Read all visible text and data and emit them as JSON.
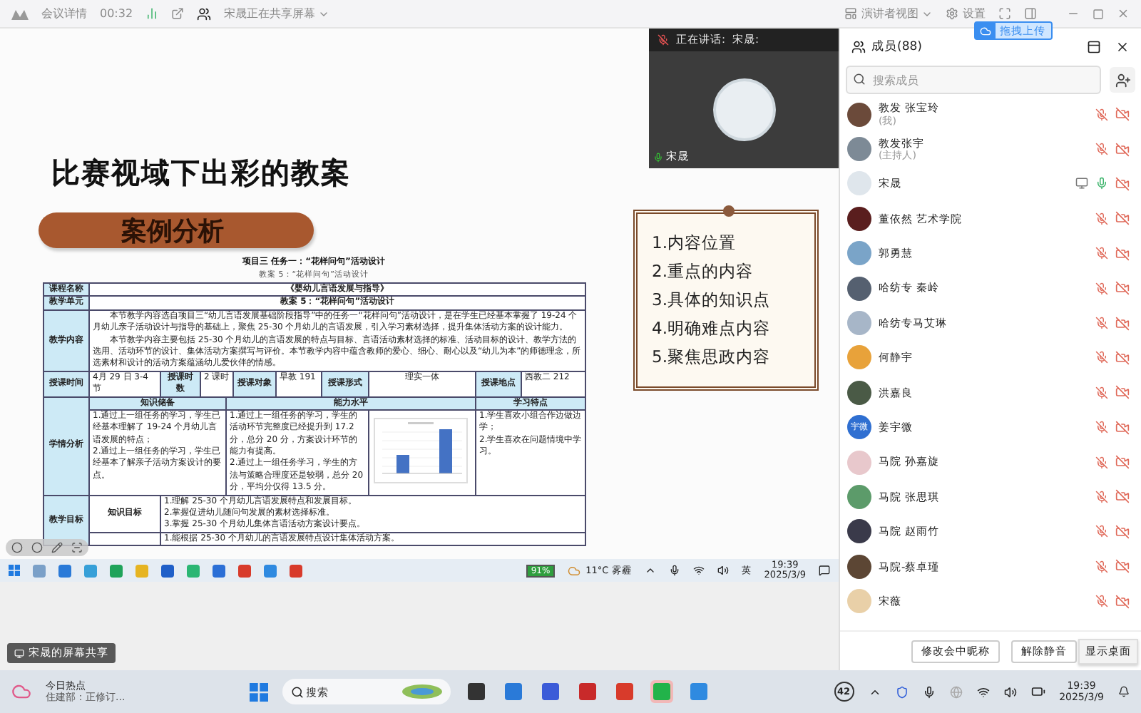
{
  "top_bar": {
    "meeting_details": "会议详情",
    "timer": "00:32",
    "sharing_status": "宋晟正在共享屏幕",
    "view_mode": "演讲者视图",
    "settings": "设置"
  },
  "upload_badge": "拖拽上传",
  "speaker_video": {
    "label": "正在讲话:",
    "speaker": "宋晟:",
    "name": "宋晟"
  },
  "slide": {
    "title": "比赛视域下出彩的教案",
    "section": "案例分析",
    "doc_title": "项目三  任务一：“花样问句”活动设计",
    "doc_subtitle": "教案 5：“花样问句”活动设计",
    "table": {
      "course": {
        "label": "课程名称",
        "value": "《婴幼儿言语发展与指导》"
      },
      "unit": {
        "label": "教学单元",
        "value": "教案 5：“花样问句”活动设计"
      },
      "content": {
        "label": "教学内容",
        "paragraphs": [
          "本节教学内容选自项目三“幼儿言语发展基础阶段指导”中的任务一“花样问句”活动设计，是在学生已经基本掌握了 19-24 个月幼儿亲子活动设计与指导的基础上，聚焦 25-30 个月幼儿的言语发展，引入学习素材选择，提升集体活动方案的设计能力。",
          "本节教学内容主要包括 25-30 个月幼儿的言语发展的特点与目标、言语活动素材选择的标准、活动目标的设计、教学方法的选用、活动环节的设计、集体活动方案撰写与评价。本节教学内容中蕴含教师的爱心、细心、耐心以及“幼儿为本”的师德理念，所选素材和设计的活动方案蕴涵幼儿爱伙伴的情感。"
        ]
      },
      "schedule": [
        {
          "label": "授课时间",
          "value": "4月 29 日 3-4 节"
        },
        {
          "label": "授课时数",
          "value": "2 课时"
        },
        {
          "label": "授课对象",
          "value": "早教 191"
        },
        {
          "label": "授课形式",
          "value": "理实一体"
        },
        {
          "label": "授课地点",
          "value": "西教二 212"
        }
      ],
      "analysis": {
        "label": "学情分析",
        "headers": [
          "知识储备",
          "能力水平",
          "学习特点"
        ],
        "knowledge": [
          "1.通过上一组任务的学习，学生已经基本理解了 19-24 个月幼儿言语发展的特点；",
          "2.通过上一组任务的学习，学生已经基本了解亲子活动方案设计的要点。"
        ],
        "ability": [
          "1.通过上一组任务的学习，学生的活动环节完整度已经提升到 17.2 分，总分 20 分，方案设计环节的能力有提高。",
          "2.通过上一组任务学习，学生的方法与策略合理度还是较弱，总分 20 分，平均分仅得 13.5 分。"
        ],
        "traits": [
          "1.学生喜欢小组合作边做边学；",
          "2.学生喜欢在问题情境中学习。"
        ]
      },
      "goals": {
        "label": "教学目标",
        "sub_label": "知识目标",
        "items": [
          "1.理解 25-30 个月幼儿言语发展特点和发展目标。",
          "2.掌握促进幼儿随问句发展的素材选择标准。",
          "3.掌握 25-30 个月幼儿集体言语活动方案设计要点。"
        ],
        "next_item": "1.能根据 25-30 个月幼儿的言语发展特点设计集体活动方案。"
      }
    },
    "note_list": [
      "1.内容位置",
      "2.重点的内容",
      "3.具体的知识点",
      "4.明确难点内容",
      "5.聚焦思政内容"
    ]
  },
  "remote_taskbar": {
    "battery": "91%",
    "weather": "11°C 雾霾",
    "ime": "英",
    "time": "19:39",
    "date": "2025/3/9"
  },
  "share_badge": "宋晟的屏幕共享",
  "members_panel": {
    "title": "成员(88)",
    "search": {
      "placeholder": "搜索成员"
    },
    "members": [
      {
        "name": "教发 张宝玲",
        "note": "(我)",
        "muted": true,
        "sharing": false
      },
      {
        "name": "教发张宇",
        "note": "(主持人)",
        "muted": true,
        "sharing": false
      },
      {
        "name": "宋晟",
        "muted": false,
        "sharing": true
      },
      {
        "name": "董依然 艺术学院",
        "muted": true,
        "sharing": false
      },
      {
        "name": "郭勇慧",
        "muted": true,
        "sharing": false
      },
      {
        "name": "哈纺专 秦岭",
        "muted": true,
        "sharing": false
      },
      {
        "name": "哈纺专马艾琳",
        "muted": true,
        "sharing": false
      },
      {
        "name": "何静宇",
        "muted": true,
        "sharing": false
      },
      {
        "name": "洪嘉良",
        "muted": true,
        "sharing": false
      },
      {
        "name": "姜宇微",
        "avatar_text": "宇微",
        "muted": true,
        "sharing": false
      },
      {
        "name": "马院 孙嘉旋",
        "muted": true,
        "sharing": false
      },
      {
        "name": "马院 张思琪",
        "muted": true,
        "sharing": false
      },
      {
        "name": "马院 赵雨竹",
        "muted": true,
        "sharing": false
      },
      {
        "name": "马院-蔡卓瑾",
        "muted": true,
        "sharing": false
      },
      {
        "name": "宋薇",
        "muted": true,
        "sharing": false
      }
    ],
    "buttons": [
      "修改会中昵称",
      "解除静音"
    ]
  },
  "tooltip": "显示桌面",
  "taskbar": {
    "news_title": "今日热点",
    "news_text": "住建部：正修订...",
    "search": {
      "placeholder": "搜索"
    },
    "badge": "42",
    "time": "19:39",
    "date": "2025/3/9"
  }
}
